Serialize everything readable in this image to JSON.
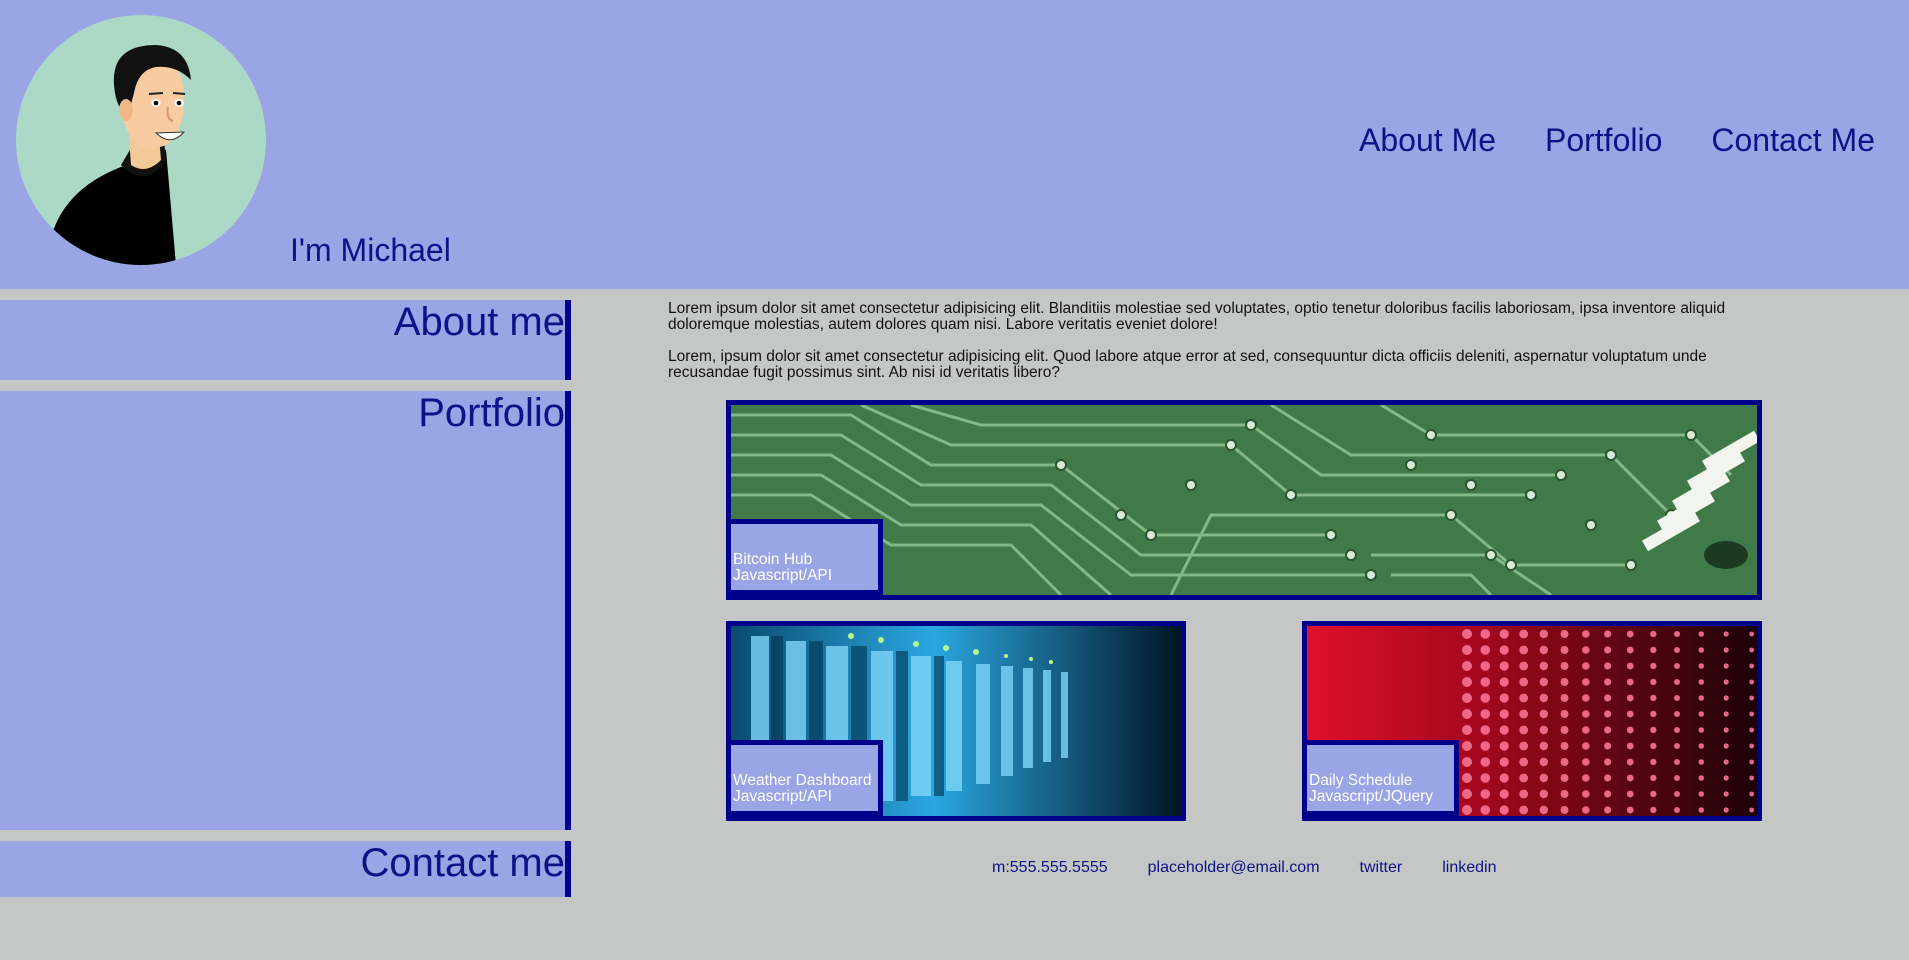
{
  "header": {
    "greeting": "I'm Michael",
    "avatar_icon": "avatar-illustration",
    "nav": {
      "about": "About Me",
      "portfolio": "Portfolio",
      "contact": "Contact Me"
    }
  },
  "sidebar": {
    "about": "About me",
    "portfolio": "Portfolio",
    "contact": "Contact me"
  },
  "about": {
    "paragraphs": [
      "Lorem ipsum dolor sit amet consectetur adipisicing elit. Blanditiis molestiae sed voluptates, optio tenetur doloribus facilis laboriosam, ipsa inventore aliquid doloremque molestias, autem dolores quam nisi. Labore veritatis eveniet dolore!",
      "Lorem, ipsum dolor sit amet consectetur adipisicing elit. Quod labore atque error at sed, consequuntur dicta officiis deleniti, aspernatur voluptatum unde recusandae fugit possimus sint. Ab nisi id veritatis libero?"
    ]
  },
  "portfolio": {
    "projects": [
      {
        "title": "Bitcoin Hub",
        "tech": "Javascript/API",
        "image": "circuit-board"
      },
      {
        "title": "Weather Dashboard",
        "tech": "Javascript/API",
        "image": "server-rack"
      },
      {
        "title": "Daily Schedule",
        "tech": "Javascript/JQuery",
        "image": "red-led-wall"
      }
    ]
  },
  "contact": {
    "phone": "m:555.555.5555",
    "email": "placeholder@email.com",
    "twitter": "twitter",
    "linkedin": "linkedin"
  },
  "colors": {
    "header_bg": "#99a5e5",
    "page_bg": "#c5c7c6",
    "accent": "#00008b",
    "text": "#0c1388"
  }
}
